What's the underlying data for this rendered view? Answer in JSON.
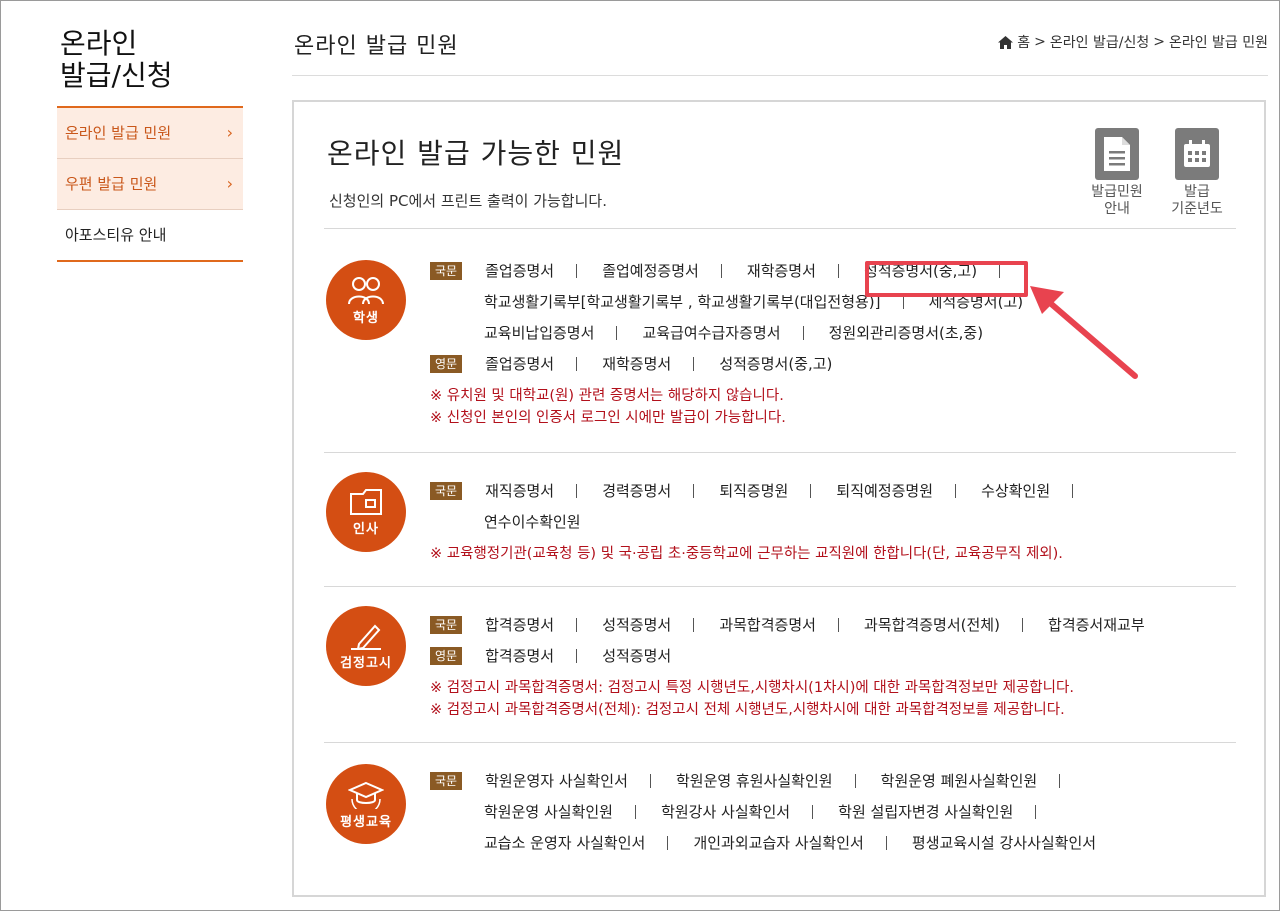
{
  "sidebar": {
    "title_line1": "온라인",
    "title_line2": "발급/신청",
    "items": [
      {
        "label": "온라인 발급 민원",
        "chevron": "›"
      },
      {
        "label": "우편 발급 민원",
        "chevron": "›"
      },
      {
        "label": "아포스티유 안내"
      }
    ]
  },
  "header": {
    "title": "온라인 발급 민원",
    "breadcrumb": [
      "홈",
      "온라인 발급/신청",
      "온라인 발급 민원"
    ],
    "breadcrumb_sep": ">"
  },
  "main": {
    "title": "온라인 발급 가능한 민원",
    "subtitle": "신청인의 PC에서 프린트 출력이 가능합니다.",
    "tools": [
      {
        "line1": "발급민원",
        "line2": "안내",
        "icon": "document-icon"
      },
      {
        "line1": "발급",
        "line2": "기준년도",
        "icon": "calendar-icon"
      }
    ]
  },
  "sections": [
    {
      "icon_label": "학생",
      "icon": "students-icon",
      "groups": [
        {
          "badge": "국문",
          "lines": [
            [
              "졸업증명서",
              "졸업예정증명서",
              "재학증명서",
              "성적증명서(중,고)"
            ],
            [
              "학교생활기록부[학교생활기록부 , 학교생활기록부(대입전형용)]",
              "제적증명서(고)"
            ],
            [
              "교육비납입증명서",
              "교육급여수급자증명서",
              "정원외관리증명서(초,중)"
            ]
          ]
        },
        {
          "badge": "영문",
          "lines": [
            [
              "졸업증명서",
              "재학증명서",
              "성적증명서(중,고)"
            ]
          ]
        }
      ],
      "notes": [
        "※ 유치원 및 대학교(원) 관련 증명서는 해당하지 않습니다.",
        "※ 신청인 본인의 인증서 로그인 시에만 발급이 가능합니다."
      ]
    },
    {
      "icon_label": "인사",
      "icon": "folder-icon",
      "groups": [
        {
          "badge": "국문",
          "lines": [
            [
              "재직증명서",
              "경력증명서",
              "퇴직증명원",
              "퇴직예정증명원",
              "수상확인원"
            ],
            [
              "연수이수확인원"
            ]
          ]
        }
      ],
      "notes": [
        "※ 교육행정기관(교육청 등) 및 국·공립 초·중등학교에 근무하는 교직원에 한합니다(단, 교육공무직 제외)."
      ]
    },
    {
      "icon_label": "검정고시",
      "icon": "pencil-icon",
      "groups": [
        {
          "badge": "국문",
          "lines": [
            [
              "합격증명서",
              "성적증명서",
              "과목합격증명서",
              "과목합격증명서(전체)",
              "합격증서재교부"
            ]
          ]
        },
        {
          "badge": "영문",
          "lines": [
            [
              "합격증명서",
              "성적증명서"
            ]
          ]
        }
      ],
      "notes": [
        "※ 검정고시 과목합격증명서: 검정고시 특정 시행년도,시행차시(1차시)에 대한 과목합격정보만 제공합니다.",
        "※ 검정고시 과목합격증명서(전체): 검정고시 전체 시행년도,시행차시에 대한 과목합격정보를 제공합니다."
      ]
    },
    {
      "icon_label": "평생교육",
      "icon": "graduation-cap-icon",
      "groups": [
        {
          "badge": "국문",
          "lines": [
            [
              "학원운영자 사실확인서",
              "학원운영 휴원사실확인원",
              "학원운영 폐원사실확인원"
            ],
            [
              "학원운영 사실확인원",
              "학원강사 사실확인서",
              "학원 설립자변경 사실확인원"
            ],
            [
              "교습소 운영자 사실확인서",
              "개인과외교습자 사실확인서",
              "평생교육시설 강사사실확인서"
            ]
          ]
        }
      ],
      "notes": []
    }
  ],
  "colors": {
    "accent": "#e0691c",
    "icon_bg": "#d44e13",
    "badge_bg": "#8a5a24",
    "note_text": "#b2101b",
    "highlight": "#e8434f"
  }
}
